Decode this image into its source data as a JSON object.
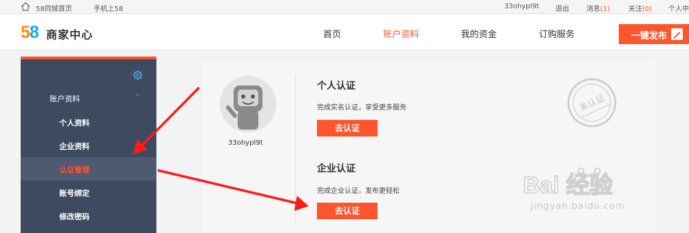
{
  "topbar": {
    "home_link": "58同城首页",
    "mobile_link": "手机上58",
    "username": "33ohypl9t",
    "logout": "退出",
    "messages_label": "消息",
    "messages_count": "(1)",
    "follow_label": "关注",
    "follow_count": "(0)",
    "personal_center": "个人中"
  },
  "header": {
    "logo_5": "5",
    "logo_8": "8",
    "logo_text": "商家中心",
    "nav": [
      {
        "label": "首页"
      },
      {
        "label": "账户资料"
      },
      {
        "label": "我的资金"
      },
      {
        "label": "订购服务"
      }
    ],
    "active_nav": "账户资料",
    "publish_label": "一键发布",
    "accent_color": "#ff552e"
  },
  "sidebar": {
    "section_title": "账户资料",
    "items": [
      {
        "label": "个人资料"
      },
      {
        "label": "企业资料"
      },
      {
        "label": "认证管理"
      },
      {
        "label": "账号绑定"
      },
      {
        "label": "修改密码"
      }
    ],
    "active_item": "认证管理",
    "bg_color": "#3e4a5f"
  },
  "profile": {
    "username": "33ohypl9t"
  },
  "personal_cert": {
    "title": "个人认证",
    "description": "完成实名认证，享受更多服务",
    "button": "去认证"
  },
  "company_cert": {
    "title": "企业认证",
    "description": "完成企业认证，发布更轻松",
    "button": "去认证"
  },
  "stamp": {
    "text": "未认证"
  },
  "watermark": {
    "brand": "Bai 经验",
    "url": "jingyan.baidu.com"
  }
}
